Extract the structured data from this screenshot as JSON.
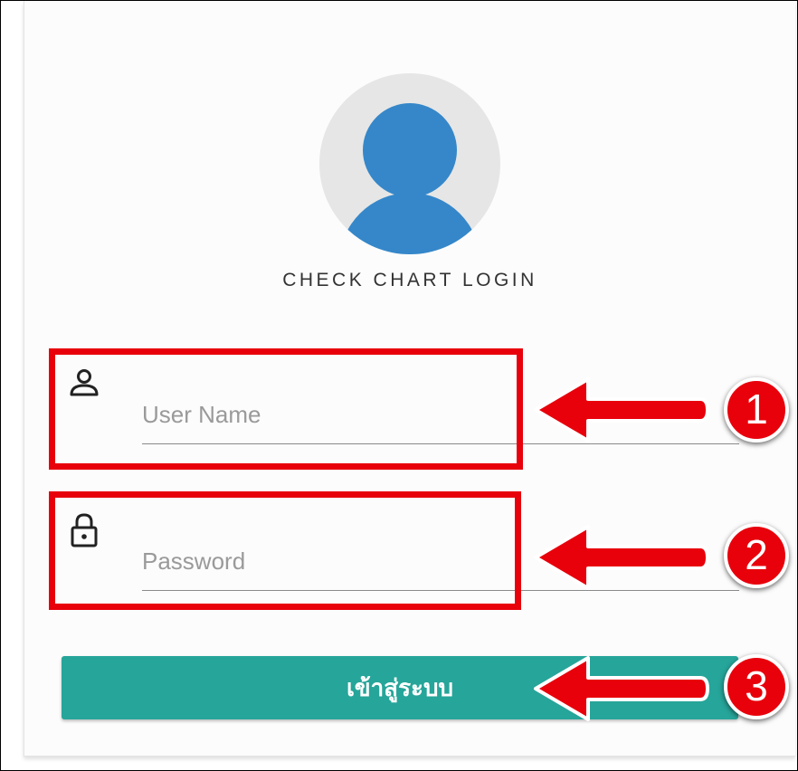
{
  "login": {
    "title": "CHECK CHART LOGIN",
    "username_placeholder": "User Name",
    "password_placeholder": "Password",
    "submit_label": "เข้าสู่ระบบ"
  },
  "annotations": {
    "badge_1": "1",
    "badge_2": "2",
    "badge_3": "3"
  },
  "icons": {
    "avatar": "user-avatar-icon",
    "username": "user-icon",
    "password": "lock-icon",
    "pointer": "arrow-left-icon"
  },
  "colors": {
    "accent": "#26a59a",
    "avatar_blue": "#3587c9",
    "annotation_red": "#e8000b"
  }
}
